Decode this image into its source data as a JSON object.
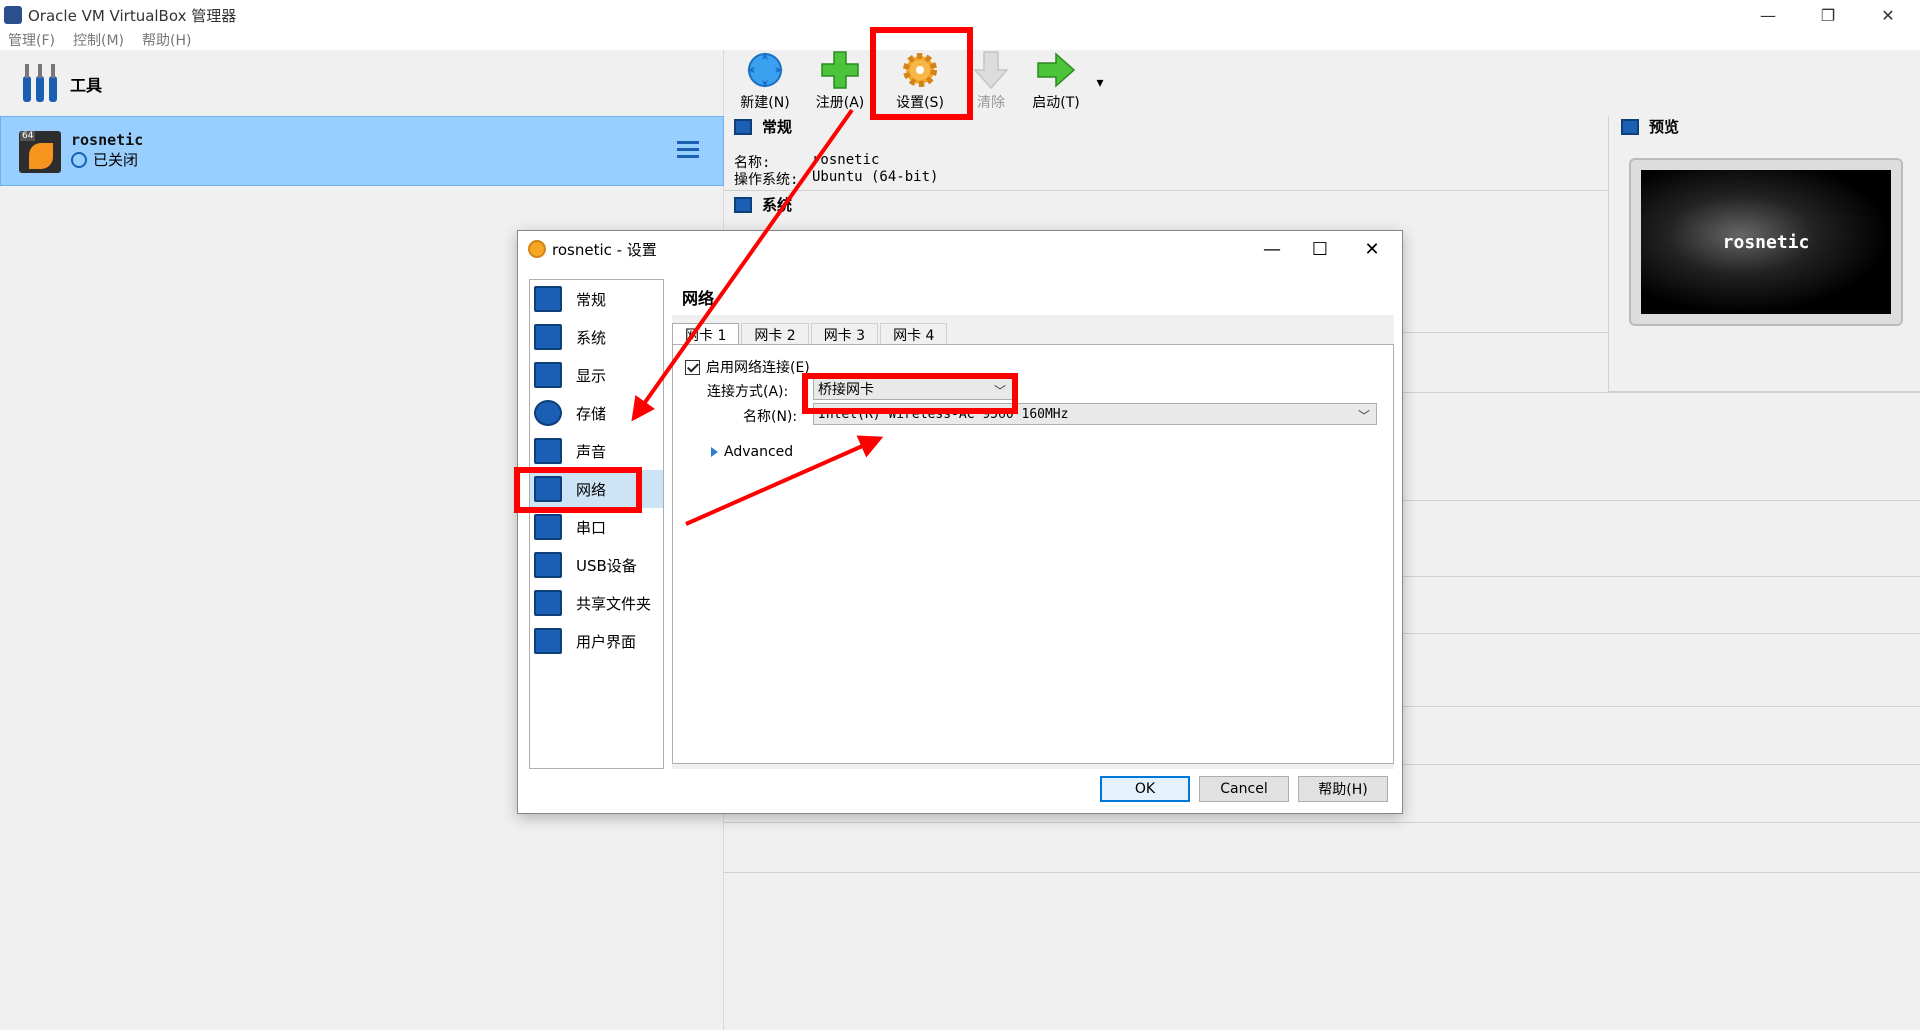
{
  "window": {
    "title": "Oracle VM VirtualBox 管理器",
    "minimize": "—",
    "restore": "❐",
    "close": "✕"
  },
  "menu": [
    "管理(F)",
    "控制(M)",
    "帮助(H)"
  ],
  "tools": {
    "label": "工具"
  },
  "vm": {
    "name": "rosnetic",
    "state": "已关闭",
    "badge": "64"
  },
  "toolbar": {
    "new": "新建(N)",
    "register": "注册(A)",
    "settings": "设置(S)",
    "discard": "清除",
    "start": "启动(T)",
    "dropdown": "▾"
  },
  "details": {
    "general_head": "常规",
    "name_label": "名称:",
    "name_value": "rosnetic",
    "os_label": "操作系统:",
    "os_value": "Ubuntu (64-bit)",
    "system_head": "系统"
  },
  "preview": {
    "head": "预览",
    "screen_text": "rosnetic"
  },
  "dialog": {
    "title": "rosnetic - 设置",
    "minimize": "—",
    "maximize": "☐",
    "close": "✕",
    "categories": [
      "常规",
      "系统",
      "显示",
      "存储",
      "声音",
      "网络",
      "串口",
      "USB设备",
      "共享文件夹",
      "用户界面"
    ],
    "selected_category": "网络",
    "page_title": "网络",
    "tabs": [
      "网卡 1",
      "网卡 2",
      "网卡 3",
      "网卡 4"
    ],
    "enable_label": "启用网络连接(E)",
    "enabled": true,
    "attach_label": "连接方式(A):",
    "attach_value": "桥接网卡",
    "name_label": "名称(N):",
    "name_value": "Intel(R) Wireless-AC 9560 160MHz",
    "advanced_label": "Advanced",
    "ok": "OK",
    "cancel": "Cancel",
    "help": "帮助(H)"
  },
  "colors": {
    "annotation": "#ff0000",
    "selection": "#99cfff",
    "accent": "#1a5fb4"
  }
}
